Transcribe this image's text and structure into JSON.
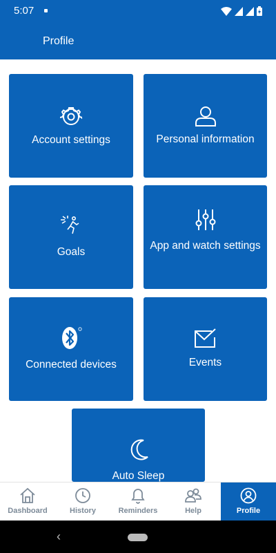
{
  "status_bar": {
    "time": "5:07"
  },
  "header": {
    "title": "Profile"
  },
  "tiles": [
    {
      "label": "Account settings",
      "icon": "gear-icon"
    },
    {
      "label": "Personal information",
      "icon": "person-icon"
    },
    {
      "label": "Goals",
      "icon": "goals-runner-icon"
    },
    {
      "label": "App and watch settings",
      "icon": "sliders-icon"
    },
    {
      "label": "Connected devices",
      "icon": "bluetooth-icon"
    },
    {
      "label": "Events",
      "icon": "envelope-check-icon"
    },
    {
      "label": "Auto Sleep",
      "icon": "moon-icon"
    }
  ],
  "bottom_nav": {
    "items": [
      {
        "label": "Dashboard",
        "icon": "home-icon"
      },
      {
        "label": "History",
        "icon": "clock-icon"
      },
      {
        "label": "Reminders",
        "icon": "bell-icon"
      },
      {
        "label": "Help",
        "icon": "people-icon"
      },
      {
        "label": "Profile",
        "icon": "profile-icon"
      }
    ],
    "active_index": 4
  },
  "colors": {
    "brand": "#0b63b8",
    "nav_inactive": "#7d8b99"
  }
}
